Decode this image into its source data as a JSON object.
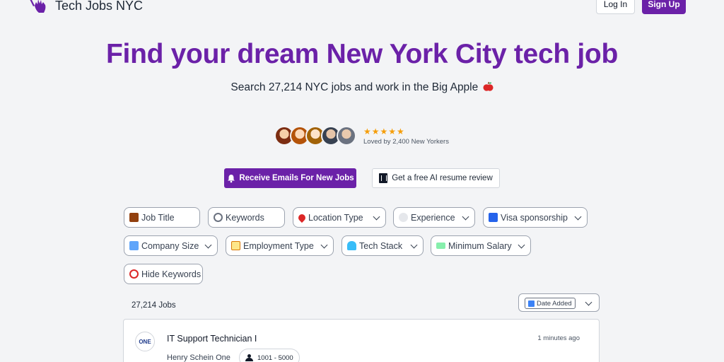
{
  "header": {
    "brand": "Tech Jobs NYC",
    "login_label": "Log In",
    "signup_label": "Sign Up"
  },
  "hero": {
    "title": "Find your dream New York City tech job",
    "subtitle": "Search 27,214 NYC jobs and work in the Big Apple"
  },
  "social_proof": {
    "rating_stars": 5,
    "stars_text": "★★★★★",
    "loved_text": "Loved by 2,400 New Yorkers"
  },
  "cta": {
    "emails_label": "Receive Emails For New Jobs",
    "resume_label": "Get a free AI resume review"
  },
  "filters": [
    {
      "label": "Job Title",
      "icon": "briefcase-icon",
      "dropdown": false
    },
    {
      "label": "Keywords",
      "icon": "magnifier-icon",
      "dropdown": false
    },
    {
      "label": "Location Type",
      "icon": "pin-icon",
      "dropdown": true
    },
    {
      "label": "Experience",
      "icon": "circle-icon",
      "dropdown": true
    },
    {
      "label": "Visa sponsorship",
      "icon": "passport-control-icon",
      "dropdown": true
    },
    {
      "label": "Company Size",
      "icon": "hash-icon",
      "dropdown": true
    },
    {
      "label": "Employment Type",
      "icon": "memo-icon",
      "dropdown": true
    },
    {
      "label": "Tech Stack",
      "icon": "stack-icon",
      "dropdown": true
    },
    {
      "label": "Minimum Salary",
      "icon": "money-icon",
      "dropdown": true
    },
    {
      "label": "Hide Keywords",
      "icon": "prohibited-icon",
      "dropdown": false
    }
  ],
  "results": {
    "count_label": "27,214 Jobs",
    "sort_label": "Date Added"
  },
  "jobs": [
    {
      "title": "IT Support Technician I",
      "company": "Henry Schein One",
      "logo_text": "ONE",
      "posted": "1 minutes ago",
      "company_size": "1001 - 5000"
    }
  ],
  "colors": {
    "brand_purple": "#6b21a8",
    "background": "#f3f4f6",
    "star": "#f59e0b"
  }
}
